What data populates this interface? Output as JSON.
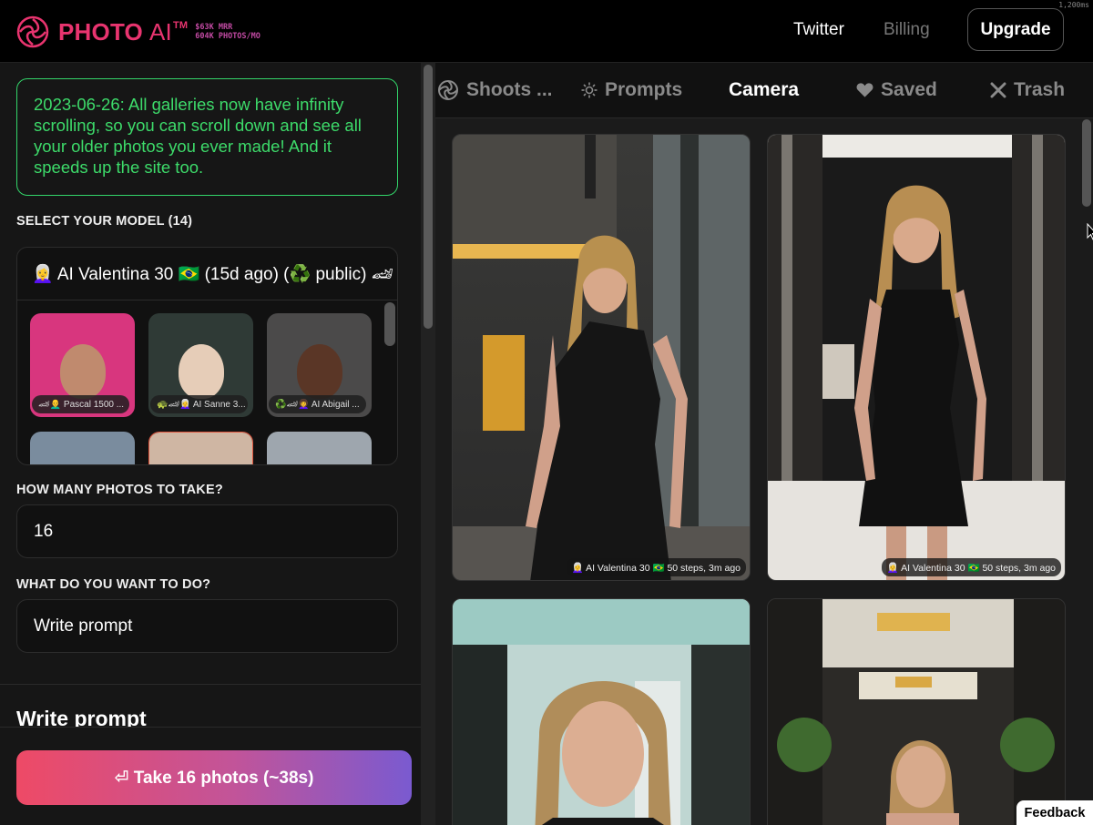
{
  "header": {
    "brand_name": "PHOTO",
    "brand_ai": "AI",
    "brand_tm": "TM",
    "stats_line1": "$63K MRR",
    "stats_line2": "604K PHOTOS/MO",
    "nav": {
      "twitter": "Twitter",
      "billing": "Billing",
      "upgrade": "Upgrade"
    },
    "timer": "1,200ms"
  },
  "sidebar": {
    "notice": "2023-06-26: All galleries now have infinity scrolling, so you can scroll down and see all your older photos you ever made! And it speeds up the site too.",
    "select_model_label": "SELECT YOUR MODEL (14)",
    "selected_model": "👩‍🦳 AI Valentina 30 🇧🇷 (15d ago) (♻️ public) 🏎",
    "models": [
      {
        "tag": "🏎👨‍🦲 Pascal 1500 ...",
        "bg": "#d8367e"
      },
      {
        "tag": "🐢🏎👩‍🦳 AI Sanne 3...",
        "bg": "#2f3a36"
      },
      {
        "tag": "♻️🏎👩‍🦱 AI Abigail ...",
        "bg": "#4b4a4a"
      },
      {
        "tag": "",
        "bg": "#7a8c9e"
      },
      {
        "tag": "",
        "bg": "#cfb6a3"
      },
      {
        "tag": "",
        "bg": "#9ea6ae"
      }
    ],
    "photo_count_label": "HOW MANY PHOTOS TO TAKE?",
    "photo_count_value": "16",
    "action_label": "WHAT DO YOU WANT TO DO?",
    "action_value": "Write prompt",
    "write_prompt_title": "Write prompt",
    "take_button": "⏎ Take 16 photos (~38s)"
  },
  "tabs": [
    {
      "label": "Shoots ...",
      "icon": "swirl-icon"
    },
    {
      "label": "Prompts",
      "icon": "sparkle-icon"
    },
    {
      "label": "Camera",
      "icon": ""
    },
    {
      "label": "Saved",
      "icon": "heart-icon"
    },
    {
      "label": "Trash",
      "icon": "x-icon"
    }
  ],
  "gallery": [
    {
      "caption": "👩‍🦳 AI Valentina 30 🇧🇷 50 steps, 3m ago"
    },
    {
      "caption": "👩‍🦳 AI Valentina 30 🇧🇷 50 steps, 3m ago"
    },
    {
      "caption": ""
    },
    {
      "caption": ""
    }
  ],
  "feedback": "Feedback",
  "colors": {
    "accent_pink": "#e8346f",
    "notice_green": "#3ddb6a",
    "gradient_start": "#ee4a66",
    "gradient_end": "#7a5ad0"
  }
}
